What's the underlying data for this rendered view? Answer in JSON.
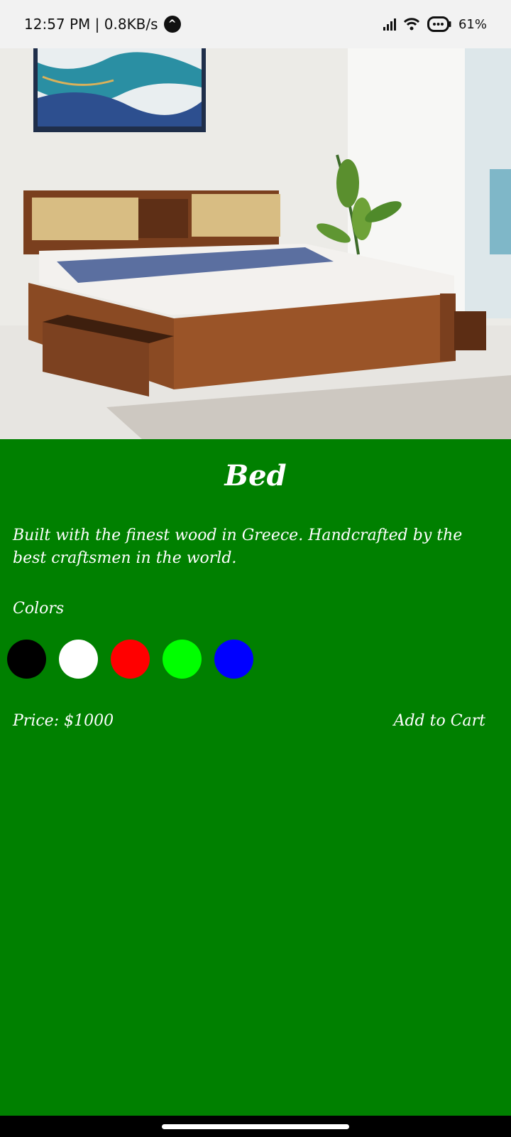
{
  "status_bar": {
    "time_speed": "12:57 PM | 0.8KB/s",
    "battery": "61%",
    "icons": [
      "nav-icon",
      "signal-icon",
      "wifi-icon",
      "battery-icon"
    ]
  },
  "product": {
    "image_alt": "wooden bed with storage drawers",
    "title": "Bed",
    "description": "Built with the finest wood in Greece. Handcrafted by the best craftsmen in the world.",
    "colors_label": "Colors",
    "colors": [
      "#000000",
      "#ffffff",
      "#ff0000",
      "#00ff00",
      "#0000ff"
    ],
    "price": "Price: $1000",
    "add_to_cart": "Add to Cart"
  },
  "theme": {
    "background": "#008000",
    "text": "#ffffff"
  }
}
